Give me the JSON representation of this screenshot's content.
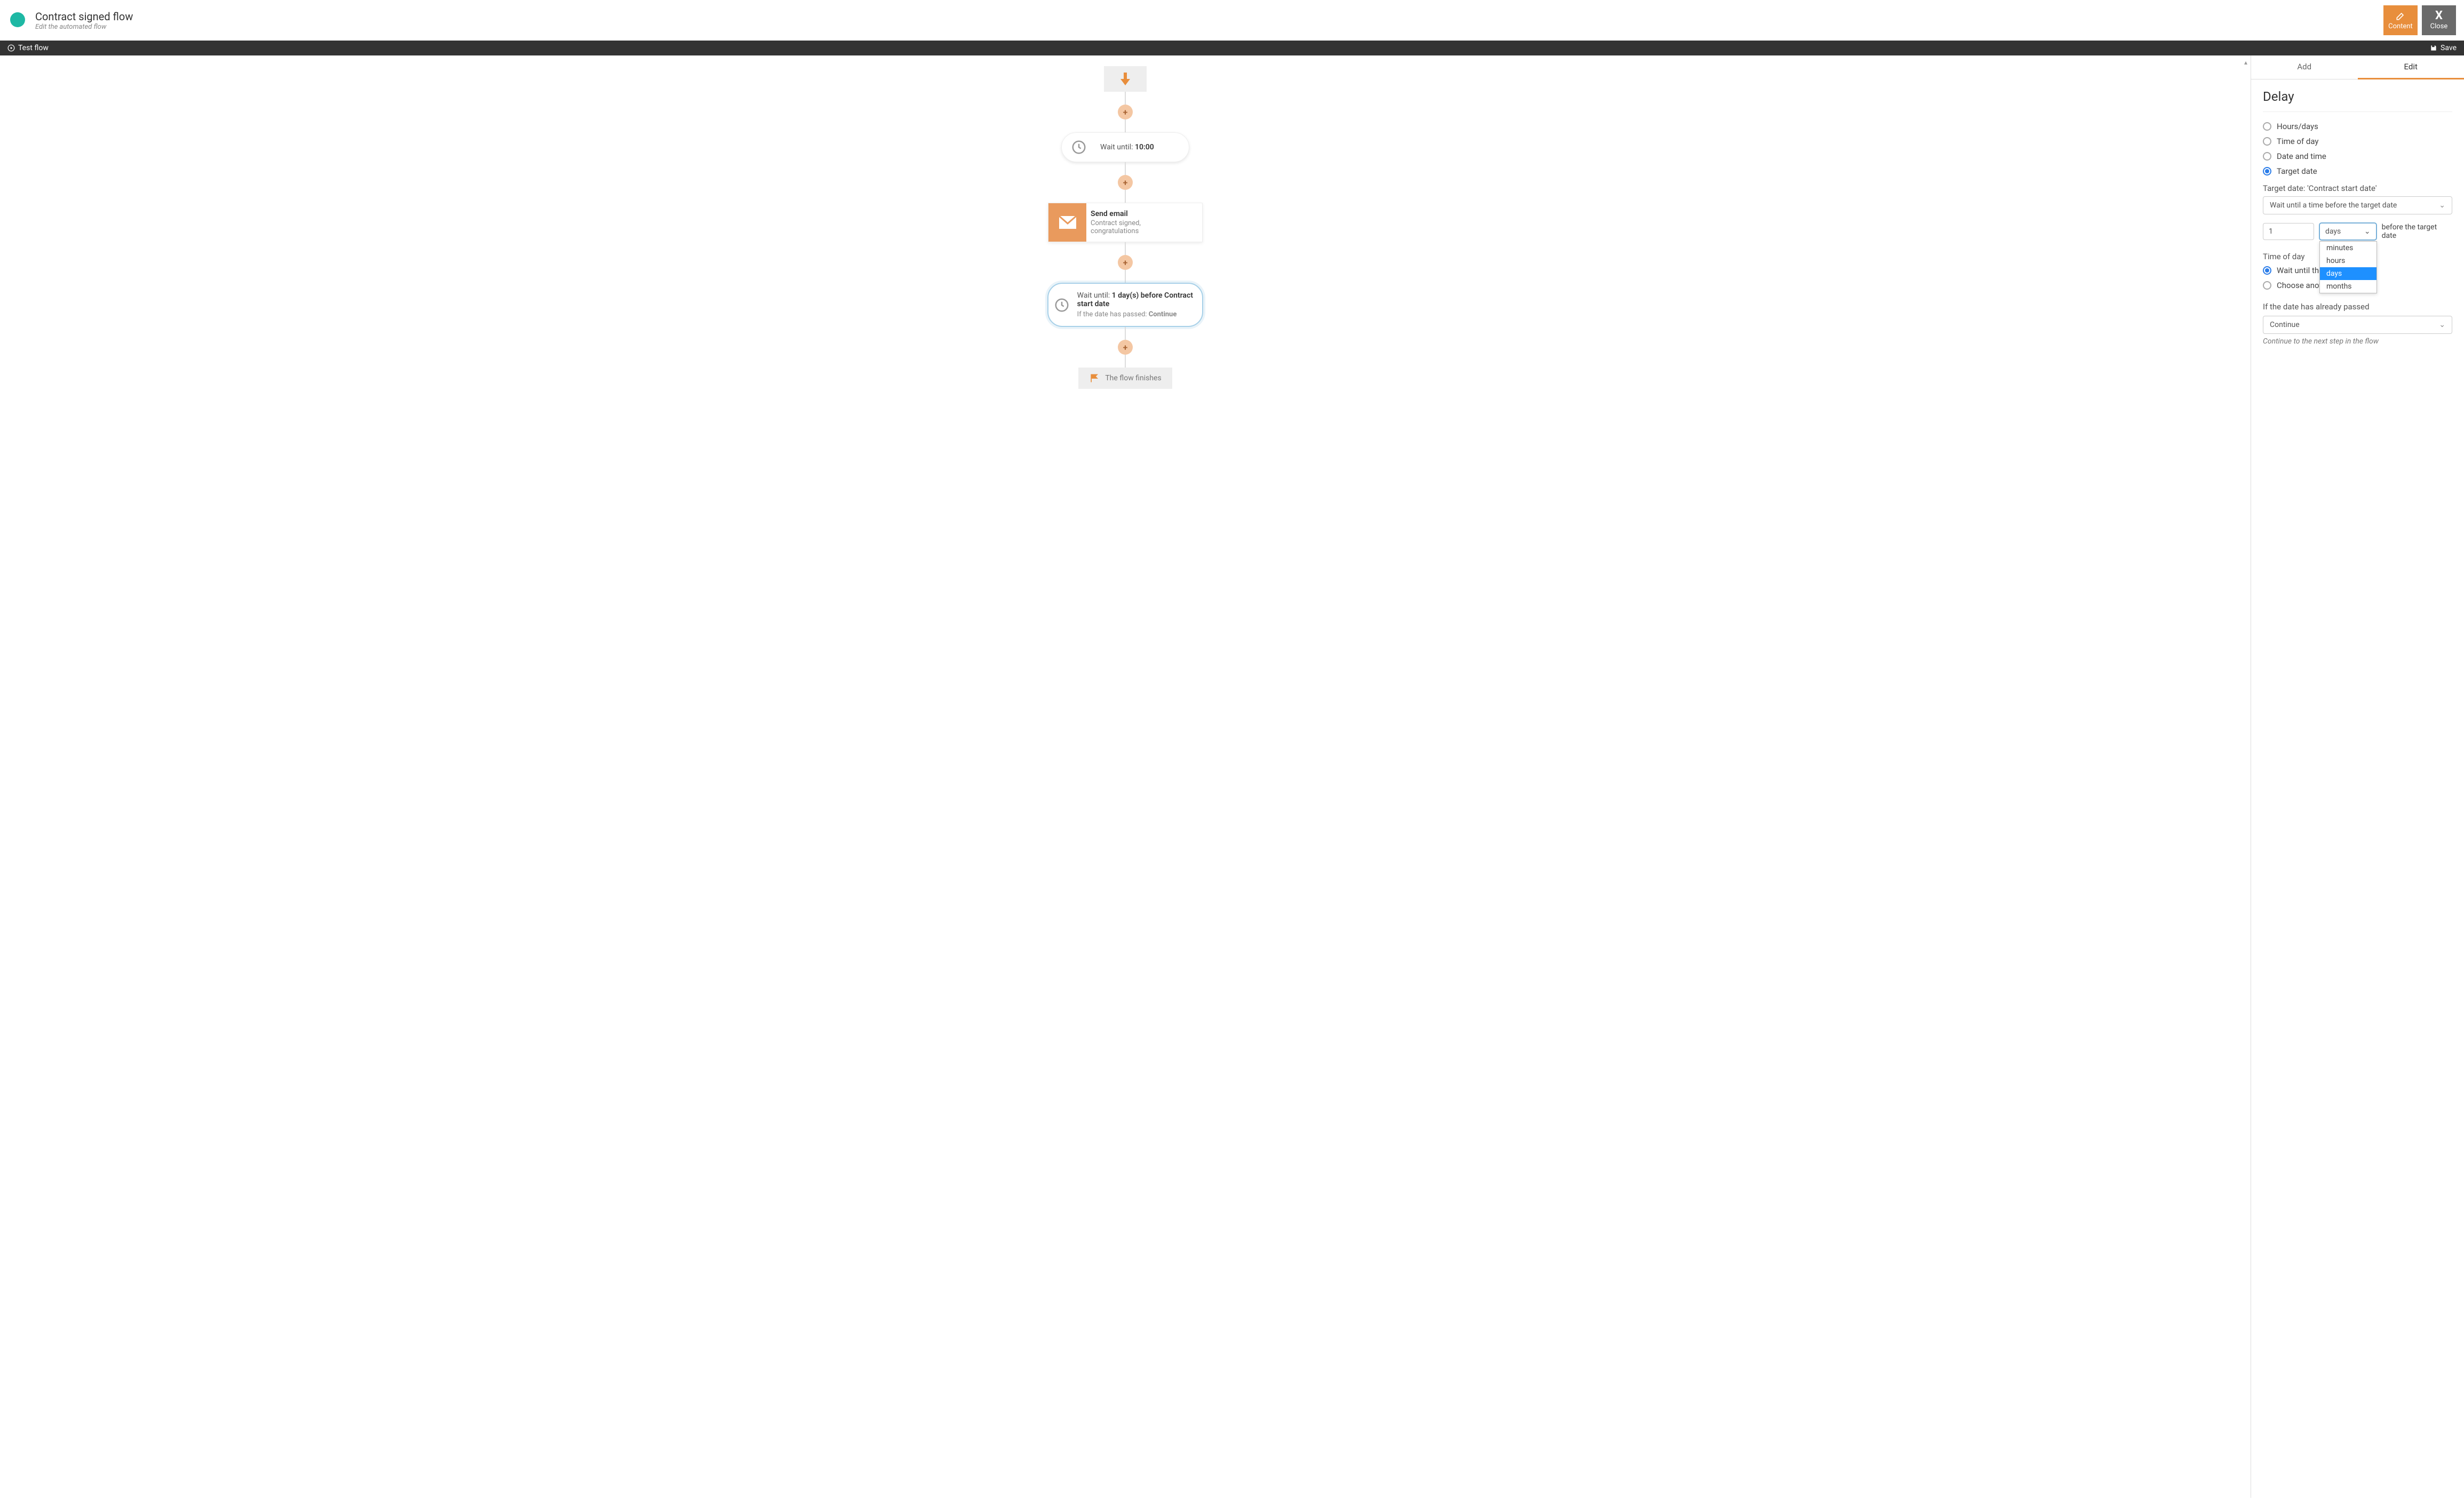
{
  "header": {
    "title": "Contract signed flow",
    "subtitle": "Edit the automated flow",
    "content_btn": "Content",
    "close_btn": "Close"
  },
  "darkbar": {
    "test_flow": "Test flow",
    "save": "Save"
  },
  "flow": {
    "wait1_prefix": "Wait until: ",
    "wait1_time": "10:00",
    "email_title": "Send email",
    "email_subtitle": "Contract signed, congratulations",
    "wait2_prefix": "Wait until: ",
    "wait2_bold": "1 day(s) before Contract start date",
    "wait2_sub_prefix": "If the date has passed: ",
    "wait2_sub_val": "Continue",
    "finish": "The flow finishes"
  },
  "sidebar": {
    "tab_add": "Add",
    "tab_edit": "Edit",
    "panel_title": "Delay",
    "radios": {
      "hours_days": "Hours/days",
      "time_of_day": "Time of day",
      "date_time": "Date and time",
      "target_date": "Target date"
    },
    "target_label": "Target date: 'Contract start date'",
    "target_select": "Wait until a time before the target date",
    "num_value": "1",
    "unit_value": "days",
    "unit_after": "before the target date",
    "unit_options": [
      "minutes",
      "hours",
      "days",
      "months"
    ],
    "tod_label": "Time of day",
    "tod_opt1": "Wait until the",
    "tod_opt2": "Choose another time",
    "passed_label": "If the date has already passed",
    "passed_select": "Continue",
    "passed_helper": "Continue to the next step in the flow"
  }
}
